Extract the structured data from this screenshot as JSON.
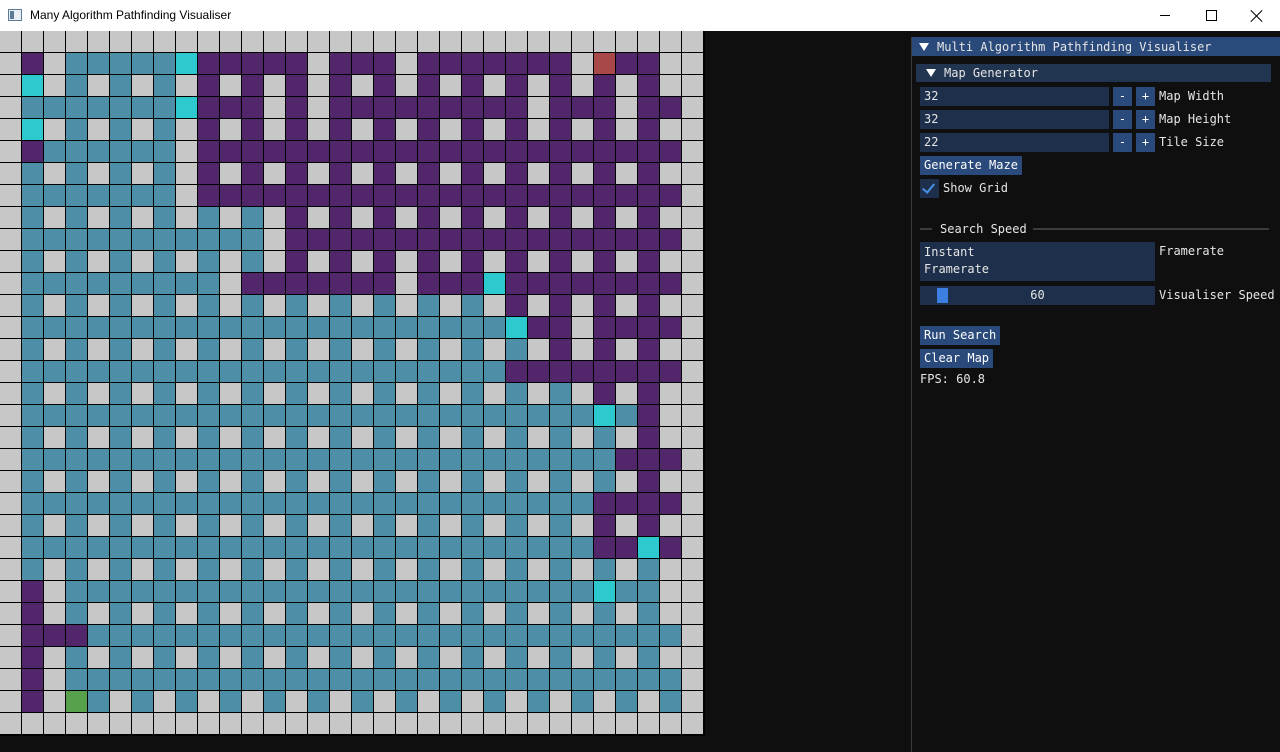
{
  "window": {
    "title": "Many Algorithm Pathfinding Visualiser"
  },
  "panel": {
    "title": "Multi Algorithm Pathfinding Visualiser",
    "map_generator": {
      "header": "Map Generator",
      "map_width": {
        "value": "32",
        "label": "Map Width"
      },
      "map_height": {
        "value": "32",
        "label": "Map Height"
      },
      "tile_size": {
        "value": "22",
        "label": "Tile Size"
      },
      "minus_label": "-",
      "plus_label": "+",
      "generate_button": "Generate Maze",
      "show_grid": {
        "label": "Show Grid",
        "checked": true
      }
    },
    "search_speed": {
      "header": "Search Speed",
      "options": [
        "Instant",
        "Framerate"
      ],
      "selected_label": "Framerate",
      "visualiser_speed": {
        "value": "60",
        "label": "Visualiser Speed",
        "min": 1,
        "max": 1000
      }
    },
    "run_button": "Run Search",
    "clear_button": "Clear Map",
    "fps_text": "FPS: 60.8"
  },
  "maze": {
    "rows": 32,
    "cols": 32,
    "legend": {
      ".": "wall",
      "o": "open",
      "V": "visited",
      "F": "frontier",
      "P": "path",
      "S": "start",
      "E": "end"
    },
    "colors": {
      "wall": "#c7c7c7",
      "open": "#0f0f0f",
      "visited": "#52266b",
      "frontier": "#2ec9cf",
      "path": "#4c8fa6",
      "start": "#57a14d",
      "end": "#a84848"
    },
    "grid": [
      "................................",
      ".V.PPPPPFVVVVV.VVV.VVVVVVV.EVV..",
      ".F.P.P.P.V.V.V.V.V.V.V.V.V.V.V..",
      ".PPPPPPPFVVV.V.VVVVVVVVV.VVV.VV.",
      ".F.P.P.P.V.V.V.V.V.V.V.V.V.V.V..",
      ".VPPPPPP.VVVVVVVVVVVVVVVVVVVVVV.",
      ".P.P.P.P.V.V.V.V.V.V.V.V.V.V.V..",
      ".PPPPPPP.VVVVVVVVVVVVVVVVVVVVVV.",
      ".P.P.P.P.P.P.V.V.V.V.V.V.V.V.V..",
      ".PPPPPPPPPPP.VVVVVVVVVVVVVVVVVV.",
      ".P.P.P.P.P.P.V.V.V.V.V.V.V.V.V..",
      ".PPPPPPPPP.VVVVVVV.VVVFVVVVVVVV.",
      ".P.P.P.P.P.P.P.P.P.P.P.V.V.V.V..",
      ".PPPPPPPPPPPPPPPPPPPPPPFVV.VVVV.",
      ".P.P.P.P.P.P.P.P.P.P.P.P.V.V.V..",
      ".PPPPPPPPPPPPPPPPPPPPPPVVVVVVVV.",
      ".P.P.P.P.P.P.P.P.P.P.P.P.P.V.V..",
      ".PPPPPPPPPPPPPPPPPPPPPPPPPPFPV..",
      ".P.P.P.P.P.P.P.P.P.P.P.P.P.P.V..",
      ".PPPPPPPPPPPPPPPPPPPPPPPPPPPVVV.",
      ".P.P.P.P.P.P.P.P.P.P.P.P.P.P.V..",
      ".PPPPPPPPPPPPPPPPPPPPPPPPPPVVVV.",
      ".P.P.P.P.P.P.P.P.P.P.P.P.P.V.V..",
      ".PPPPPPPPPPPPPPPPPPPPPPPPPPVVFV.",
      ".P.P.P.P.P.P.P.P.P.P.P.P.P.P.P..",
      ".V.PPPPPPPPPPPPPPPPPPPPPPPPFPP..",
      ".V.P.P.P.P.P.P.P.P.P.P.P.P.P.P..",
      ".VVVPPPPPPPPPPPPPPPPPPPPPPPPPPP.",
      ".V.P.P.P.P.P.P.P.P.P.P.P.P.P.P..",
      ".V.PPPPPPPPPPPPPPPPPPPPPPPPPPPP.",
      ".V.SP.P.P.P.P.P.P.P.P.P.P.P.P.P.",
      "................................"
    ]
  }
}
